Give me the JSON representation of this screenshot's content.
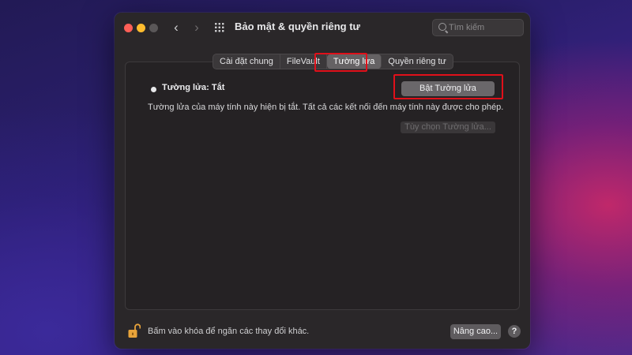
{
  "window": {
    "title": "Bảo mật & quyền riêng tư",
    "search_placeholder": "Tìm kiếm"
  },
  "tabs": [
    {
      "label": "Cài đặt chung",
      "active": false
    },
    {
      "label": "FileVault",
      "active": false
    },
    {
      "label": "Tường lửa",
      "active": true
    },
    {
      "label": "Quyền riêng tư",
      "active": false
    }
  ],
  "firewall": {
    "status_label": "Tường lửa: Tắt",
    "enable_button": "Bật Tường lửa",
    "description": "Tường lửa của máy tính này hiện bị tắt. Tất cả các kết nối đến máy tính này được cho phép.",
    "options_button": "Tùy chọn Tường lửa..."
  },
  "footer": {
    "lock_text": "Bấm vào khóa để ngăn các thay đổi khác.",
    "advanced_button": "Nâng cao...",
    "help_label": "?"
  },
  "colors": {
    "highlight": "#e0101a",
    "close": "#fe5f57",
    "minimize": "#febc2e",
    "lock": "#e8a33a"
  }
}
